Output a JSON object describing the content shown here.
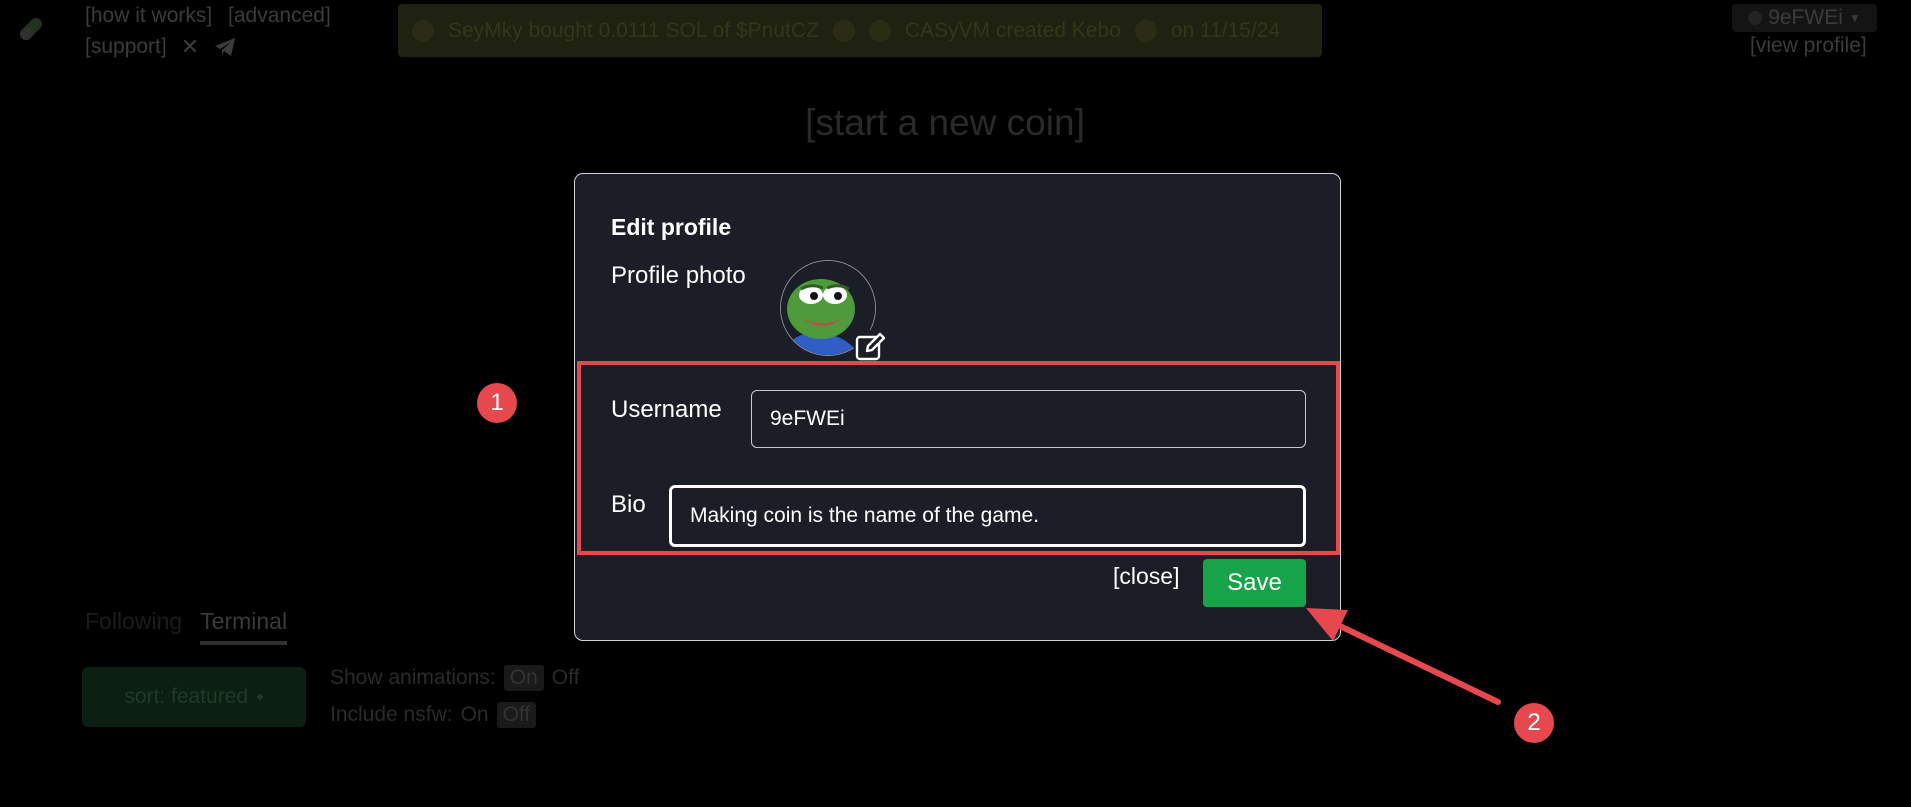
{
  "header": {
    "nav_links": [
      "[how it works]",
      "[advanced]",
      "[support]"
    ],
    "ticker": [
      "SeyMky  bought 0.0111 SOL of $PnutCZ",
      "CASyVM created Kebo",
      "on 11/15/24"
    ],
    "account": {
      "name": "9eFWEi",
      "view_profile": "[view profile]"
    }
  },
  "page": {
    "start_coin": "[start a new coin]",
    "tabs": [
      "Following",
      "Terminal"
    ],
    "sort_label": "sort: featured",
    "show_animations": {
      "label": "Show animations:",
      "on": "On",
      "off": "Off"
    },
    "include_nsfw": {
      "label": "Include nsfw:",
      "on": "On",
      "off": "Off"
    }
  },
  "modal": {
    "title": "Edit profile",
    "photo_label": "Profile photo",
    "username_label": "Username",
    "username_value": "9eFWEi",
    "bio_label": "Bio",
    "bio_value": "Making coin is the name of the game.",
    "close_label": "[close]",
    "save_label": "Save"
  },
  "annotations": {
    "marker_1": "1",
    "marker_2": "2"
  },
  "colors": {
    "save_green": "#16a34a",
    "modal_bg": "#1c1e27",
    "annotation_red": "#e5484d"
  },
  "icons": [
    "pill-logo-icon",
    "x-icon",
    "telegram-icon",
    "chevron-down-icon",
    "edit-icon",
    "avatar-image"
  ]
}
